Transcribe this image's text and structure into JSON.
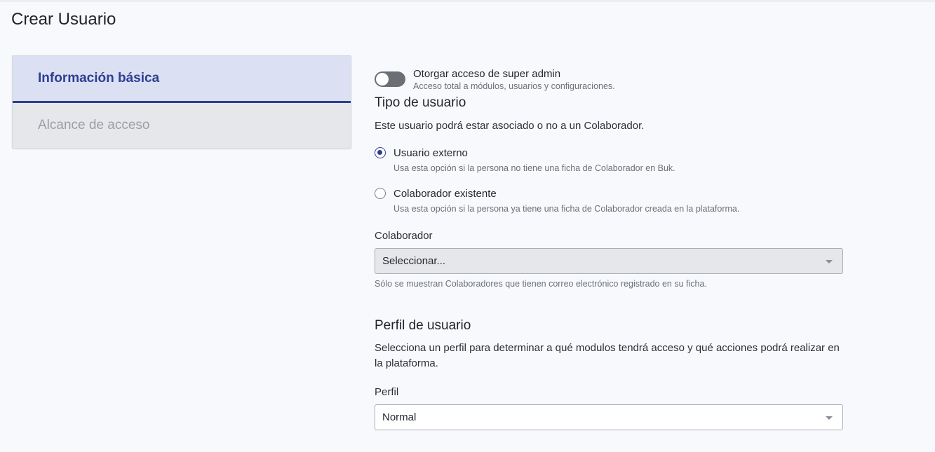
{
  "page": {
    "title": "Crear Usuario"
  },
  "tabs": [
    {
      "label": "Información básica",
      "active": true
    },
    {
      "label": "Alcance de acceso",
      "active": false
    }
  ],
  "super_admin": {
    "label": "Otorgar acceso de super admin",
    "help": "Acceso total a módulos, usuarios y configuraciones.",
    "enabled": false
  },
  "user_type": {
    "title": "Tipo de usuario",
    "description": "Este usuario podrá estar asociado o no a un Colaborador.",
    "options": [
      {
        "label": "Usuario externo",
        "help": "Usa esta opción si la persona no tiene una ficha de Colaborador en Buk.",
        "checked": true
      },
      {
        "label": "Colaborador existente",
        "help": "Usa esta opción si la persona ya tiene una ficha de Colaborador creada en la plataforma.",
        "checked": false
      }
    ]
  },
  "collaborator": {
    "label": "Colaborador",
    "value": "Seleccionar...",
    "hint": "Sólo se muestran Colaboradores que tienen correo electrónico registrado en su ficha."
  },
  "profile": {
    "title": "Perfil de usuario",
    "description": "Selecciona un perfil para determinar a qué modulos tendrá acceso y qué acciones podrá realizar en la plataforma.",
    "field_label": "Perfil",
    "value": "Normal"
  },
  "colors": {
    "accent": "#2c3f94",
    "active_tab_bg": "#dbe0f2",
    "inactive_tab_bg": "#e6e7ea",
    "toggle_off": "#6b6e74"
  }
}
